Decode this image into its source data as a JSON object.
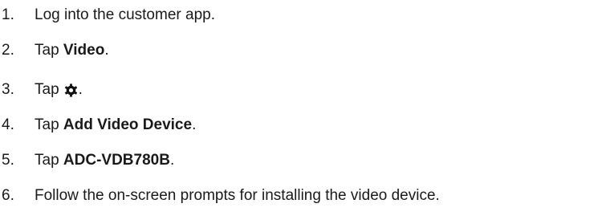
{
  "steps": [
    {
      "number": "1.",
      "before": "Log into the customer app.",
      "bold": "",
      "after": ""
    },
    {
      "number": "2.",
      "before": "Tap ",
      "bold": "Video",
      "after": "."
    },
    {
      "number": "3.",
      "before": "Tap",
      "icon": "gear-icon",
      "after": "."
    },
    {
      "number": "4.",
      "before": "Tap ",
      "bold": "Add Video Device",
      "after": "."
    },
    {
      "number": "5.",
      "before": "Tap ",
      "bold": "ADC-VDB780B",
      "after": "."
    },
    {
      "number": "6.",
      "before": "Follow the on-screen prompts for installing the video device.",
      "bold": "",
      "after": ""
    }
  ]
}
